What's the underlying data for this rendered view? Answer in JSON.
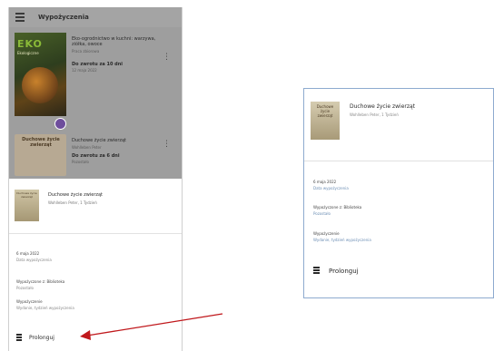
{
  "app": {
    "title": "Wypożyczenia"
  },
  "loans": [
    {
      "cover_text": "EKO",
      "cover_subtext": "Ekologiczne",
      "title": "Eko-ogrodnictwo w kuchni: warzywa, ziółka, owoce",
      "subtitle": "Praca zbiorowa",
      "due": "Do zwrotu za 10 dni",
      "due_sub": "12 maja 2022"
    },
    {
      "cover_text": "Duchowe życie zwierząt",
      "title": "Duchowe życie zwierząt",
      "subtitle": "Wohlleben Peter",
      "due": "Do zwrotu za 6 dni",
      "due_sub": "Pozostało"
    }
  ],
  "sheet": {
    "cover_text": "Duchowe życie zwierząt",
    "title": "Duchowe życie zwierząt",
    "subtitle": "Wohlleben Peter, 1 Tydzień",
    "details": [
      {
        "line1": "6 maja 2022",
        "line2": "Data wypożyczenia"
      },
      {
        "line1": "Wypożyczone z: Biblioteka",
        "line2": "Pozostało"
      },
      {
        "line1": "Wypożyczenie",
        "line2": "Wydanie, tydzień wypożyczenia"
      }
    ],
    "renew_label": "Prolonguj"
  },
  "zoom": {
    "title": "Duchowe życie zwierząt",
    "subtitle": "Wohlleben Peter, 1 Tydzień",
    "details": [
      {
        "line1": "6 maja 2022",
        "line2": "Data wypożyczenia"
      },
      {
        "line1": "Wypożyczone z: Biblioteka",
        "line2": "Pozostało"
      },
      {
        "line1": "Wypożyczenie",
        "line2": "Wydanie, tydzień wypożyczenia"
      }
    ],
    "renew_label": "Prolonguj"
  },
  "colors": {
    "header": "#a4a4a4",
    "arrow": "#c0181c",
    "zoom_border": "#8eabcf",
    "badge": "#6e4d9c"
  }
}
